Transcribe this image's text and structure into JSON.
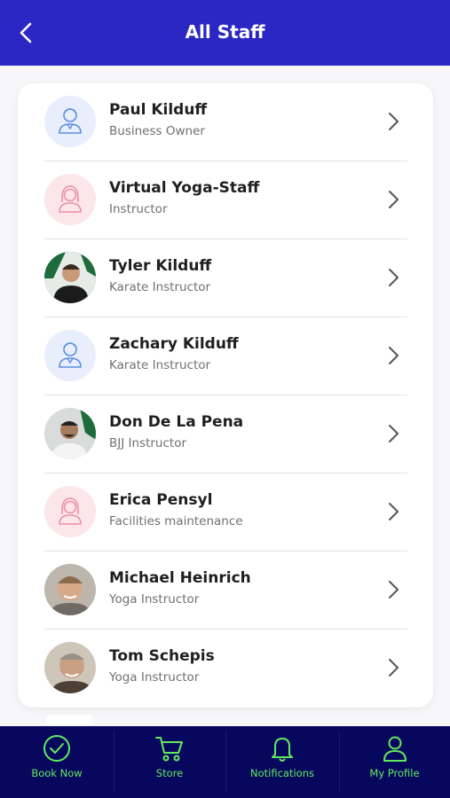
{
  "header": {
    "title": "All Staff",
    "back_icon": "chevron-left-icon"
  },
  "staff": [
    {
      "name": "Paul Kilduff",
      "role": "Business Owner",
      "avatar": "male-placeholder"
    },
    {
      "name": "Virtual Yoga-Staff",
      "role": "Instructor",
      "avatar": "female-placeholder"
    },
    {
      "name": "Tyler Kilduff",
      "role": "Karate Instructor",
      "avatar": "photo"
    },
    {
      "name": "Zachary Kilduff",
      "role": "Karate Instructor",
      "avatar": "male-placeholder"
    },
    {
      "name": "Don De La Pena",
      "role": "BJJ Instructor",
      "avatar": "photo"
    },
    {
      "name": "Erica Pensyl",
      "role": "Facilities maintenance",
      "avatar": "female-placeholder"
    },
    {
      "name": "Michael Heinrich",
      "role": "Yoga Instructor",
      "avatar": "photo"
    },
    {
      "name": "Tom Schepis",
      "role": "Yoga Instructor",
      "avatar": "photo"
    }
  ],
  "nav": [
    {
      "label": "Book Now",
      "icon": "check-circle-icon"
    },
    {
      "label": "Store",
      "icon": "cart-icon"
    },
    {
      "label": "Notifications",
      "icon": "bell-icon"
    },
    {
      "label": "My Profile",
      "icon": "user-icon"
    }
  ],
  "colors": {
    "header": "#2a27c4",
    "nav": "#07075e",
    "accent": "#62ea5e"
  }
}
